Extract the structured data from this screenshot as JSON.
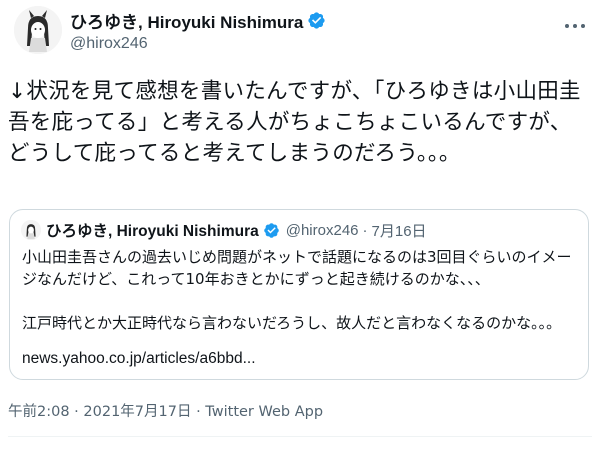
{
  "author": {
    "display_name": "ひろゆき, Hiroyuki Nishimura",
    "handle": "@hirox246",
    "avatar_icon": "avatar-illustration-icon",
    "verified_icon": "verified-badge-icon"
  },
  "more_icon": "more-dots-icon",
  "tweet": {
    "text": "↓状況を見て感想を書いたんですが、「ひろゆきは小山田圭吾を庇ってる」と考える人がちょこちょこいるんですが、どうして庇ってると考えてしまうのだろう。。。"
  },
  "quote": {
    "display_name": "ひろゆき, Hiroyuki Nishimura",
    "handle": "@hirox246",
    "separator": "·",
    "date": "7月16日",
    "text": "小山田圭吾さんの過去いじめ問題がネットで話題になるのは3回目ぐらいのイメージなんだけど、これって10年おきとかにずっと起き続けるのかな、、、\n\n江戸時代とか大正時代なら言わないだろうし、故人だと言わなくなるのかな。。。",
    "link": "news.yahoo.co.jp/articles/a6bbd..."
  },
  "footer": {
    "time": "午前2:08",
    "separator1": "·",
    "date": "2021年7月17日",
    "separator2": "·",
    "app": "Twitter Web App"
  },
  "colors": {
    "verified_blue": "#1d9bf0",
    "secondary_text": "#536471",
    "border": "#cfd9de"
  }
}
